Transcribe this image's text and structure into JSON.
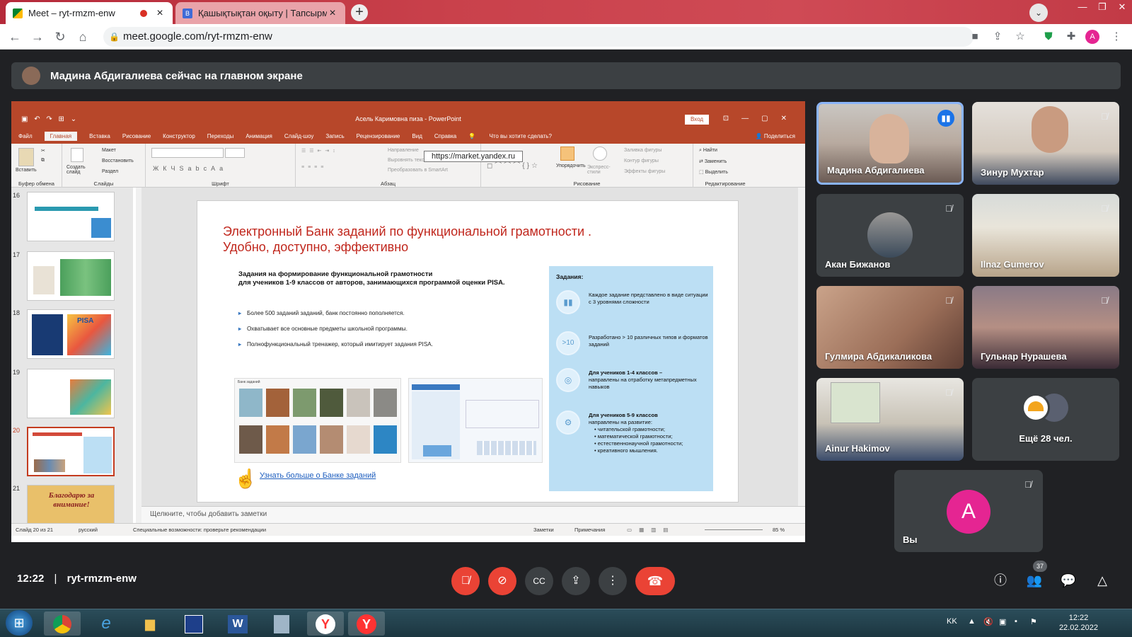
{
  "browser": {
    "tabs": [
      {
        "title": "Meet – ryt-rmzm-enw",
        "favicon": "meet-icon",
        "recording": true
      },
      {
        "title": "Қашықтықтан оқыту | Тапсырм",
        "favicon": "bilimland-icon"
      }
    ],
    "url": "meet.google.com/ryt-rmzm-enw",
    "profile_initial": "A"
  },
  "presenter_banner": {
    "text": "Мадина Абдигалиева сейчас на главном экране"
  },
  "powerpoint": {
    "title": "Асель Каримовна пиза - PowerPoint",
    "signin": "Вход",
    "menus": [
      "Файл",
      "Главная",
      "Вставка",
      "Рисование",
      "Конструктор",
      "Переходы",
      "Анимация",
      "Слайд-шоу",
      "Запись",
      "Рецензирование",
      "Вид",
      "Справка"
    ],
    "active_menu": "Главная",
    "tell_me": "Что вы хотите сделать?",
    "share": "Поделиться",
    "ribbon_groups": {
      "clipboard": "Буфер обмена",
      "slides": "Слайды",
      "font": "Шрифт",
      "paragraph": "Абзац",
      "drawing": "Рисование",
      "editing": "Редактирование"
    },
    "ribbon_items": {
      "paste": "Вставить",
      "new_slide": "Создать слайд",
      "layout": "Макет",
      "reset": "Восстановить",
      "section": "Раздел",
      "arrange": "Упорядочить",
      "quick_styles": "Экспресс-стили",
      "fill": "Заливка фигуры",
      "outline": "Контур фигуры",
      "effects": "Эффекты фигуры",
      "find": "Найти",
      "replace": "Заменить",
      "select": "Выделить",
      "direction": "Направление",
      "align": "Выровнять текст",
      "smartart": "Преобразовать в SmartArt"
    },
    "tooltip": "https://market.yandex.ru",
    "thumbnail_numbers": [
      "16",
      "17",
      "18",
      "19",
      "20",
      "21"
    ],
    "thumb_text": {
      "pisa": "PISA",
      "thanks": "Благодарю за внимание!"
    },
    "notes_placeholder": "Щелкните, чтобы добавить заметки",
    "status": {
      "slide": "Слайд 20 из 21",
      "lang": "русский",
      "accessibility": "Специальные возможности: проверьте рекомендации",
      "notes": "Заметки",
      "comments": "Примечания",
      "zoom": "85 %"
    }
  },
  "slide": {
    "title_line1": "Электронный Банк заданий по функциональной грамотности .",
    "title_line2": "Удобно, доступно, эффективно",
    "intro_line1": "Задания на формирование функциональной грамотности",
    "intro_line2": "для учеников 1-9 классов от авторов, занимающихся программой оценки PISA.",
    "bullets": [
      "Более 500 заданий заданий, банк постоянно пополняется.",
      "Охватывает все основные предметы школьной программы.",
      "Полнофункциональный тренажер, который имитирует задания PISA."
    ],
    "image_caption": "Банк заданий",
    "link": "Узнать больше о Банке заданий",
    "box_header": "Задания:",
    "box_items": [
      {
        "icon": "chart-icon",
        "text": "Каждое задание представлено в виде ситуации с 3 уровнями сложности"
      },
      {
        "icon": "gt10-icon",
        "badge": ">10",
        "text": "Разработано > 10 различных типов и форматов заданий"
      },
      {
        "icon": "target-icon",
        "text_bold": "Для учеников 1-4 классов –",
        "text": "направлены на отработку метапредметных навыков"
      },
      {
        "icon": "gears-icon",
        "text_bold": "Для учеников 5-9 классов",
        "text": "направлены на развитие:",
        "list": [
          "читательской грамотности;",
          "математической грамотности;",
          "естественнонаучной грамотности;",
          "креативного мышления."
        ]
      }
    ]
  },
  "participants": [
    {
      "name": "Мадина Абдигалиева",
      "speaking": true
    },
    {
      "name": "Зинур Мухтар",
      "muted": true
    },
    {
      "name": "Акан Бижанов",
      "muted": true
    },
    {
      "name": "Ilnaz Gumerov",
      "muted": true
    },
    {
      "name": "Гулмира Абдикаликова",
      "muted": true
    },
    {
      "name": "Гульнар Нурашева",
      "muted": true
    },
    {
      "name": "Ainur Hakimov",
      "muted": true
    },
    {
      "name": "Ещё 28 чел."
    },
    {
      "name": "Вы",
      "initial": "A",
      "muted": true
    }
  ],
  "meeting": {
    "time": "12:22",
    "code": "ryt-rmzm-enw",
    "people_count": "37"
  },
  "colors": {
    "end_call": "#ea4335",
    "accent_blue": "#1a73e8",
    "ppt_red": "#b7472a",
    "avatar_pink": "#e52592"
  },
  "taskbar": {
    "lang": "KK",
    "time": "12:22",
    "date": "22.02.2022",
    "apps": [
      "windows-start-icon",
      "chrome-icon",
      "ie-icon",
      "explorer-icon",
      "notepad-icon",
      "word-icon",
      "calculator-icon",
      "yandex-icon",
      "yandex-icon"
    ]
  }
}
